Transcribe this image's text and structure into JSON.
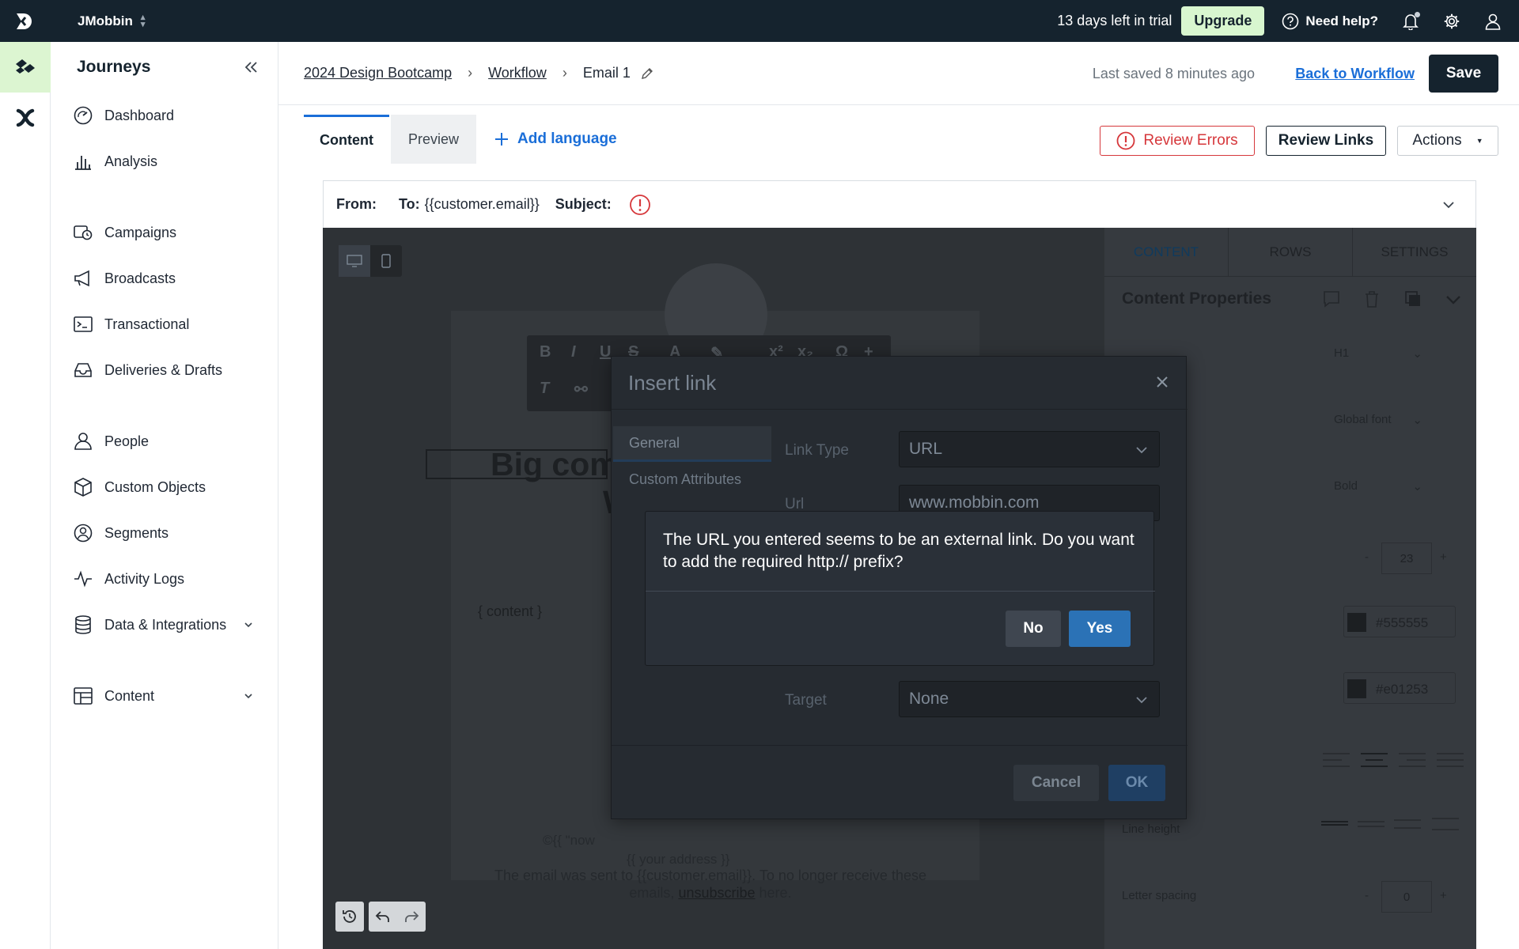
{
  "topbar": {
    "workspace": "JMobbin",
    "trial_text": "13 days left in trial",
    "upgrade_label": "Upgrade",
    "help_label": "Need help?"
  },
  "sidebar": {
    "title": "Journeys",
    "items": [
      {
        "label": "Dashboard",
        "icon": "gauge-icon"
      },
      {
        "label": "Analysis",
        "icon": "bar-chart-icon"
      },
      {
        "label": "Campaigns",
        "icon": "campaign-icon"
      },
      {
        "label": "Broadcasts",
        "icon": "megaphone-icon"
      },
      {
        "label": "Transactional",
        "icon": "terminal-icon"
      },
      {
        "label": "Deliveries & Drafts",
        "icon": "inbox-icon"
      },
      {
        "label": "People",
        "icon": "person-icon"
      },
      {
        "label": "Custom Objects",
        "icon": "cube-icon"
      },
      {
        "label": "Segments",
        "icon": "segment-icon"
      },
      {
        "label": "Activity Logs",
        "icon": "pulse-icon"
      },
      {
        "label": "Data & Integrations",
        "icon": "database-icon"
      },
      {
        "label": "Content",
        "icon": "layout-icon"
      }
    ]
  },
  "header": {
    "crumbs": [
      "2024 Design Bootcamp",
      "Workflow"
    ],
    "current": "Email 1",
    "last_saved": "Last saved 8 minutes ago",
    "back_label": "Back to Workflow",
    "save_label": "Save"
  },
  "tabs": {
    "content": "Content",
    "preview": "Preview",
    "add_language": "Add language",
    "review_errors": "Review Errors",
    "review_links": "Review Links",
    "actions": "Actions"
  },
  "email_header": {
    "from_label": "From:",
    "to_label": "To:",
    "to_value": "{{customer.email}}",
    "subject_label": "Subject:"
  },
  "editor": {
    "headline_partial": "Big com",
    "headline_line2": "W",
    "content_placeholder": "{ content }",
    "footer_line1": "The email was sent to {{customer.email}}. To no longer receive these",
    "footer_line2_pre": "emails,",
    "unsubscribe": "unsubscribe",
    "footer_line2_post": "here.",
    "copyright_partial": "©{{ \"now",
    "address_partial": "{{ your address }}"
  },
  "properties": {
    "tabs": [
      "CONTENT",
      "ROWS",
      "SETTINGS"
    ],
    "title": "Content Properties",
    "title_level": "H1",
    "font_family": "Global font",
    "font_weight": "Bold",
    "font_size": "23",
    "color_1": "#555555",
    "color_2": "#e01253",
    "line_height_label": "Line height",
    "letter_spacing_label": "Letter spacing",
    "letter_spacing": "0"
  },
  "insert_link": {
    "title": "Insert link",
    "nav": [
      "General",
      "Custom Attributes"
    ],
    "link_type_label": "Link Type",
    "link_type_value": "URL",
    "url_label": "Url",
    "url_value": "www.mobbin.com",
    "target_label": "Target",
    "target_value": "None",
    "cancel_label": "Cancel",
    "ok_label": "OK"
  },
  "confirm": {
    "message": "The URL you entered seems to be an external link. Do you want to add the required http:// prefix?",
    "no_label": "No",
    "yes_label": "Yes"
  }
}
